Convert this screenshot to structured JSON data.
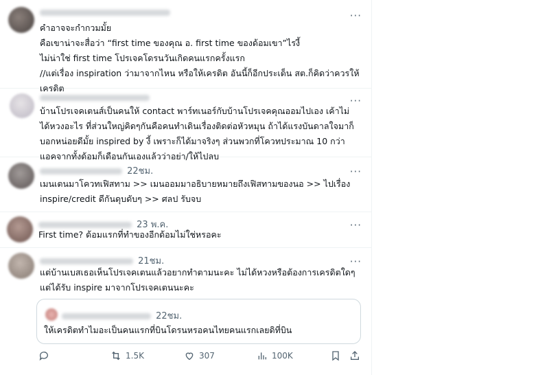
{
  "posts": [
    {
      "lines": [
        "คําอาจจะกํากวมมั้ย",
        "คือเขาน่าจะสื่อว่า “first time ของคุณ อ. first time ของด้อมเขา”ไรงี้",
        "ไม่น่าใช่ first time โปรเจคโดรนวันเกิดคนแรกครั้งแรก",
        "//แต่เรื่อง inspiration ว่ามาจากไหน หรือให้เครดิต อันนี้ก็อีกประเด็น สต.ก็คิดว่าควรให้",
        "เครดิต"
      ]
    },
    {
      "lines": [
        "บ้านโปรเจคเตนส์เป็นคนให้ contact พาร์ทเนอร์กับบ้านโปรเจคคุณออมไปเอง เค้าไม่",
        "ได้หวงอะไร ที่ส่วนใหญ่คิดๆกันคือคนทําเดินเรื่องติดต่อหัวหมุน ถ้าได้แรงบันดาลใจมาก็",
        "บอกหน่อยดีมั้ย inspired by งี้ เพราะก็ได้มาจริงๆ ส่วนพวกที่โควทประมาณ 10 กว่า",
        "แอคจากทั้งด้อมก็เดือนกันเองแล้วว่าอย่า/ให้ไปลบ"
      ]
    },
    {
      "time": "22ชม.",
      "lines": [
        "เมนเตนมาโควทเฟิสทาม >> เมนออมมาอธิบายหมายถึงเฟิสทามของนอ >> ไปเรื่อง",
        "inspire/credit ดีกันดุบดับๆ >> ศลป รับจบ"
      ]
    },
    {
      "time": "23 พ.ค.",
      "lines": [
        "First time? ด้อมแรกที่ทําของอีกด้อมไม่ใช่หรอคะ"
      ]
    },
    {
      "time": "21ชม.",
      "lines": [
        "แต่บ้านเบสเธอเห็นโปรเจคเตนแล้วอยากทําตามนะคะ ไม่ได้หวงหรือต้องการเครดิตใดๆ",
        "แต่ได้รับ inspire มาจากโปรเจคเตนนะคะ"
      ],
      "quote": {
        "time": "22ชม.",
        "text": "ให้เครดิตทําไมอะเป็นคนแรกที่บินโดรนหรอคนไทยคนแรกเลยดิที่บิน"
      }
    }
  ],
  "more_label": "···",
  "actions": {
    "reply_label": "",
    "repost_count": "1.5K",
    "like_count": "307",
    "views_count": "100K"
  },
  "colors": {
    "secondary": "#536471",
    "border": "#eff3f4",
    "text": "#0f1419"
  }
}
